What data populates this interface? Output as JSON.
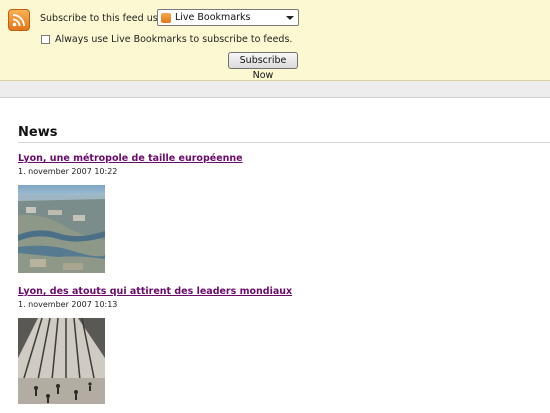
{
  "banner": {
    "subscribe_label": "Subscribe to this feed using",
    "selected_reader": "Live Bookmarks",
    "always_use_label": "Always use Live Bookmarks to subscribe to feeds.",
    "always_use_checked": false,
    "subscribe_button": "Subscribe Now"
  },
  "feed": {
    "heading": "News",
    "entries": [
      {
        "title": "Lyon, une métropole de taille européenne",
        "date": "1. november 2007 10:22",
        "image": "aerial-city-photo"
      },
      {
        "title": "Lyon, des atouts qui attirent des leaders mondiaux",
        "date": "1. november 2007 10:13",
        "image": "atrium-interior-photo"
      }
    ]
  },
  "colors": {
    "banner_bg": "#fbf8d2",
    "visited_link": "#6b0a6b",
    "rss_orange": "#e2771b"
  }
}
